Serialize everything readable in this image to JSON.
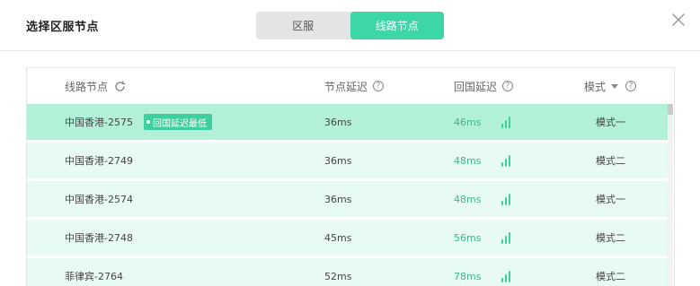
{
  "dialog": {
    "title": "选择区服节点",
    "tabs": [
      {
        "label": "区服",
        "active": false
      },
      {
        "label": "线路节点",
        "active": true
      }
    ],
    "close_icon": "close-icon"
  },
  "table": {
    "columns": {
      "node": "线路节点",
      "node_delay": "节点延迟",
      "return_delay": "回国延迟",
      "mode": "模式"
    },
    "refresh_icon": "refresh-icon",
    "help_icon": "help-icon",
    "rows": [
      {
        "name": "中国香港-2575",
        "tag": "回国延迟最低",
        "node_delay": "36ms",
        "return_delay": "46ms",
        "mode": "模式一",
        "selected": true
      },
      {
        "name": "中国香港-2749",
        "tag": "",
        "node_delay": "36ms",
        "return_delay": "48ms",
        "mode": "模式二",
        "selected": false
      },
      {
        "name": "中国香港-2574",
        "tag": "",
        "node_delay": "36ms",
        "return_delay": "48ms",
        "mode": "模式一",
        "selected": false
      },
      {
        "name": "中国香港-2748",
        "tag": "",
        "node_delay": "45ms",
        "return_delay": "56ms",
        "mode": "模式二",
        "selected": false
      },
      {
        "name": "菲律宾-2764",
        "tag": "",
        "node_delay": "52ms",
        "return_delay": "78ms",
        "mode": "模式二",
        "selected": false
      }
    ]
  },
  "colors": {
    "accent": "#3dd6a6",
    "selected_row": "#b3f0d8",
    "row": "#e8fbf3",
    "latency_text": "#3ab88a"
  }
}
